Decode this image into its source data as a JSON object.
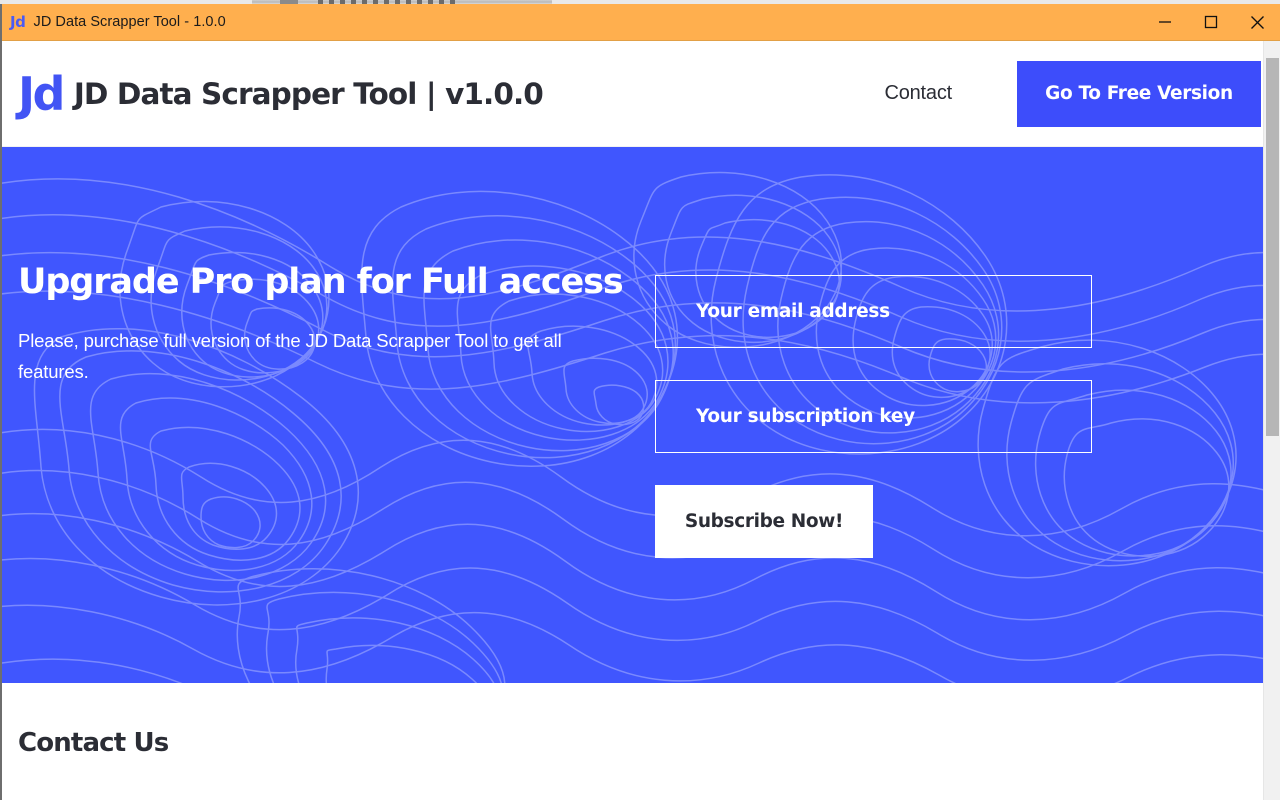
{
  "window": {
    "titlebar": {
      "logo_text": "Jd",
      "title": "JD Data Scrapper Tool - 1.0.0",
      "background_color": "#ffaf4e",
      "controls": [
        {
          "name": "minimize",
          "glyph": "—"
        },
        {
          "name": "maximize",
          "glyph": "□"
        },
        {
          "name": "close",
          "glyph": "✕"
        }
      ]
    }
  },
  "header": {
    "brand_logo": "Jd",
    "brand_title": "JD Data Scrapper Tool | v1.0.0",
    "nav": {
      "contact_label": "Contact",
      "cta_label": "Go To Free Version",
      "cta_color": "#3d4dfb"
    }
  },
  "hero": {
    "background_color": "#4056fe",
    "title": "Upgrade Pro plan for Full access",
    "subtitle": "Please, purchase full version of the JD Data Scrapper Tool to get all features.",
    "form": {
      "email_placeholder": "Your email address",
      "email_value": "",
      "key_placeholder": "Your subscription key",
      "key_value": "",
      "submit_label": "Subscribe Now!"
    }
  },
  "contact": {
    "heading": "Contact Us"
  }
}
